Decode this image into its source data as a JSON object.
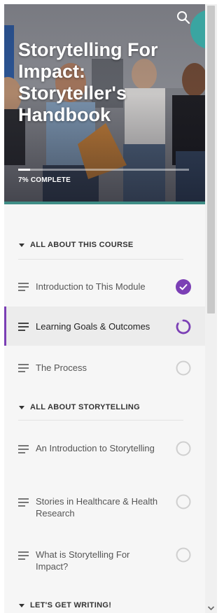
{
  "course": {
    "title": "Storytelling For Impact: Storyteller's Handbook",
    "progress_label": "7% COMPLETE",
    "progress_percent": 7
  },
  "colors": {
    "accent": "#7b3fb5",
    "teal": "#3aa5a1",
    "panel_bg": "#f6f6f6"
  },
  "icons": {
    "search": "search-icon",
    "section_toggle": "caret-down-icon",
    "lesson_type": "text-lines-icon",
    "complete": "check-circle-icon",
    "in_progress": "progress-ring-icon",
    "not_started": "empty-circle-icon",
    "scroll_down": "chevron-down-icon"
  },
  "sections": [
    {
      "label": "ALL ABOUT THIS COURSE",
      "lessons": [
        {
          "title": "Introduction to This Module",
          "status": "complete"
        },
        {
          "title": "Learning Goals & Outcomes",
          "status": "in_progress"
        },
        {
          "title": "The Process",
          "status": "not_started"
        }
      ]
    },
    {
      "label": "ALL ABOUT STORYTELLING",
      "lessons": [
        {
          "title": "An Introduction to Storytelling",
          "status": "not_started"
        },
        {
          "title": "Stories in Healthcare & Health Research",
          "status": "not_started"
        },
        {
          "title": "What is Storytelling For Impact?",
          "status": "not_started"
        }
      ]
    },
    {
      "label": "LET'S GET WRITING!",
      "lessons": []
    }
  ]
}
